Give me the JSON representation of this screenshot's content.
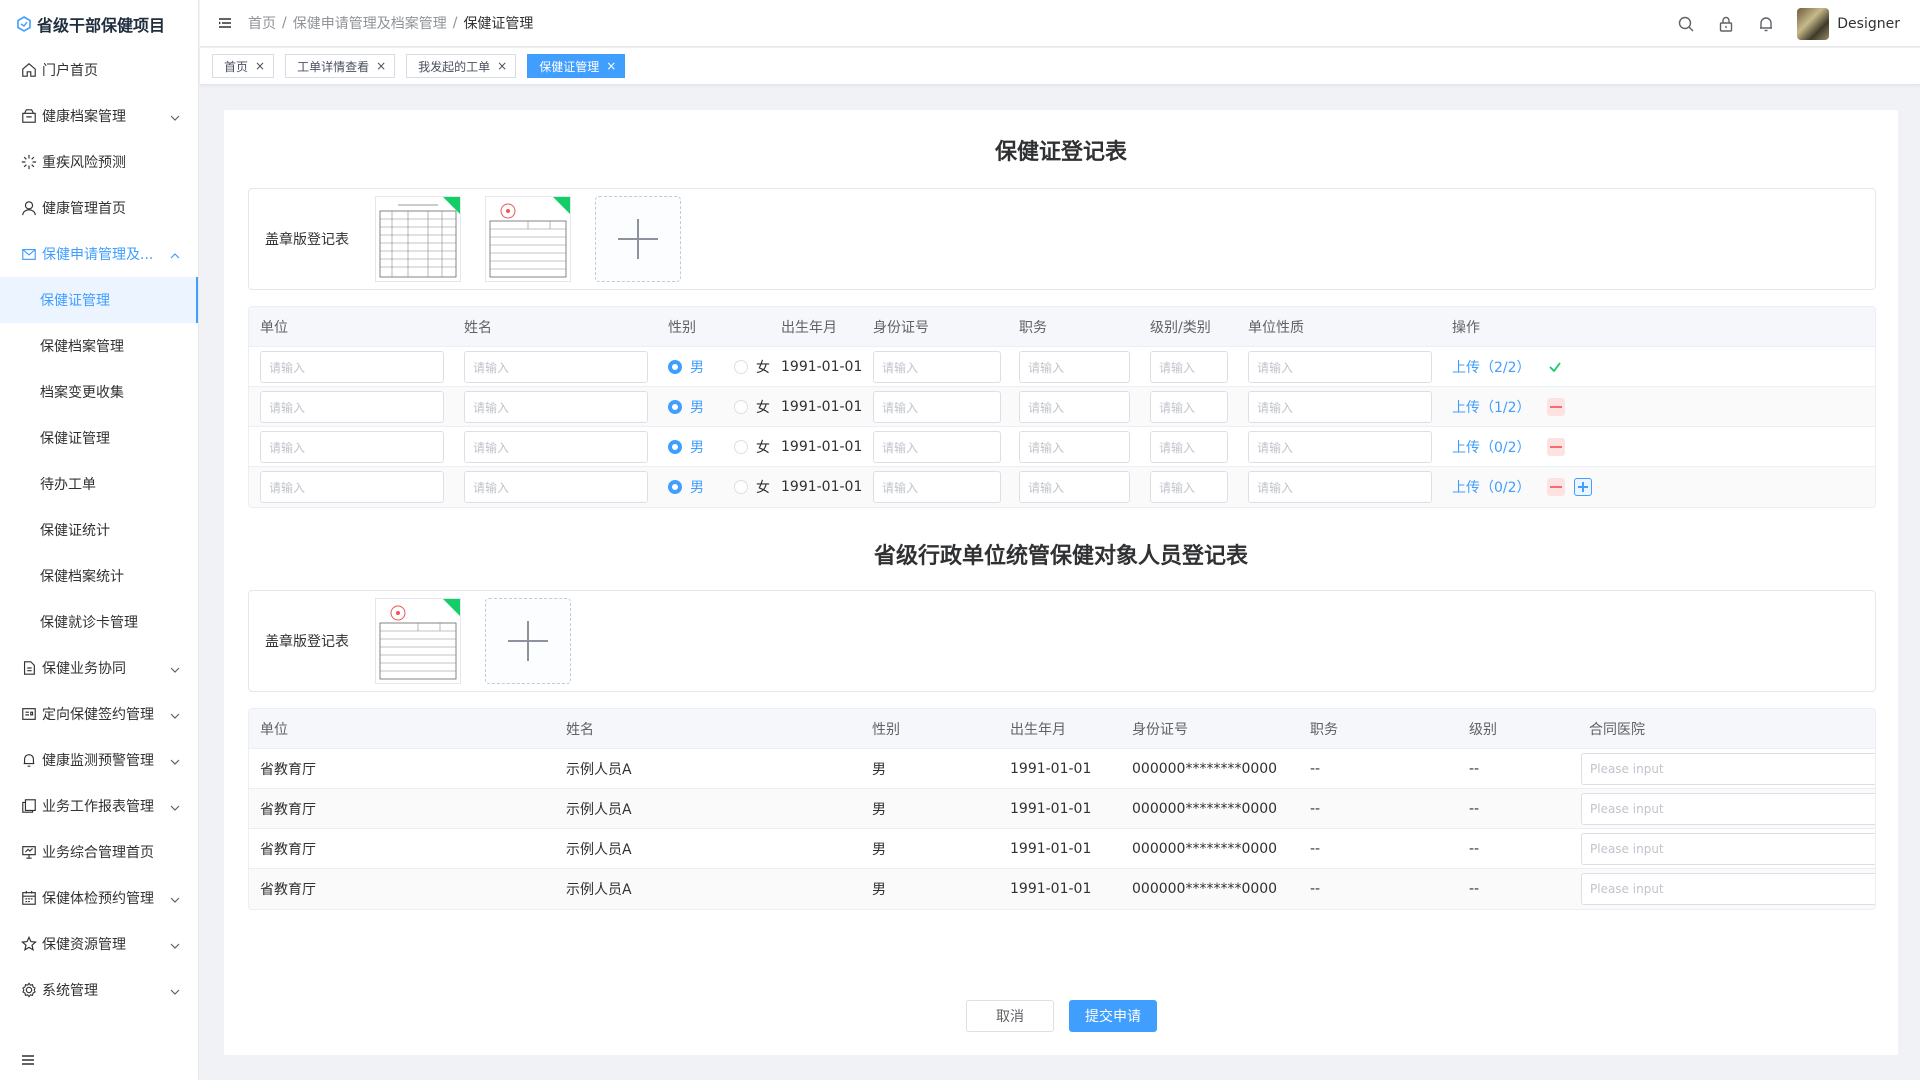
{
  "app": {
    "title": "省级干部保健项目"
  },
  "sidebar": {
    "items": [
      {
        "label": "门户首页",
        "icon": "home-icon",
        "has_children": false
      },
      {
        "label": "健康档案管理",
        "icon": "archive-icon",
        "has_children": true
      },
      {
        "label": "重疾风险预测",
        "icon": "loading-icon",
        "has_children": false
      },
      {
        "label": "健康管理首页",
        "icon": "user-icon",
        "has_children": false
      },
      {
        "label": "保健申请管理及...",
        "icon": "message-icon",
        "has_children": true,
        "open": true
      },
      {
        "label": "保健业务协同",
        "icon": "document-icon",
        "has_children": true
      },
      {
        "label": "定向保健签约管理",
        "icon": "postcard-icon",
        "has_children": true
      },
      {
        "label": "健康监测预警管理",
        "icon": "bell-icon",
        "has_children": true
      },
      {
        "label": "业务工作报表管理",
        "icon": "copy-document-icon",
        "has_children": true
      },
      {
        "label": "业务综合管理首页",
        "icon": "data-board-icon",
        "has_children": false
      },
      {
        "label": "保健体检预约管理",
        "icon": "calendar-icon",
        "has_children": true
      },
      {
        "label": "保健资源管理",
        "icon": "star-icon",
        "has_children": true
      },
      {
        "label": "系统管理",
        "icon": "setting-icon",
        "has_children": true
      }
    ],
    "sub_items": [
      {
        "label": "保健证管理",
        "active": true
      },
      {
        "label": "保健档案管理"
      },
      {
        "label": "档案变更收集"
      },
      {
        "label": "保健证管理"
      },
      {
        "label": "待办工单"
      },
      {
        "label": "保健证统计"
      },
      {
        "label": "保健档案统计"
      },
      {
        "label": "保健就诊卡管理"
      }
    ]
  },
  "header": {
    "breadcrumb": [
      "首页",
      "保健申请管理及档案管理",
      "保健证管理"
    ],
    "breadcrumb_sep": "/",
    "username": "Designer"
  },
  "tabs": [
    {
      "label": "首页",
      "active": false
    },
    {
      "label": "工单详情查看",
      "active": false
    },
    {
      "label": "我发起的工单",
      "active": false
    },
    {
      "label": "保健证管理",
      "active": true
    }
  ],
  "tab_close": "×",
  "form1": {
    "title": "保健证登记表",
    "upload_label": "盖章版登记表",
    "columns": [
      "单位",
      "姓名",
      "性别",
      "出生年月",
      "身份证号",
      "职务",
      "级别/类别",
      "单位性质",
      "操作"
    ],
    "placeholder": "请输入",
    "gender_male": "男",
    "gender_female": "女",
    "rows": [
      {
        "birth": "1991-01-01",
        "upload": "上传（2/2）",
        "status": "done"
      },
      {
        "birth": "1991-01-01",
        "upload": "上传（1/2）",
        "status": "remove"
      },
      {
        "birth": "1991-01-01",
        "upload": "上传（0/2）",
        "status": "remove"
      },
      {
        "birth": "1991-01-01",
        "upload": "上传（0/2）",
        "status": "remove-add"
      }
    ]
  },
  "form2": {
    "title": "省级行政单位统管保健对象人员登记表",
    "upload_label": "盖章版登记表",
    "columns": [
      "单位",
      "姓名",
      "性别",
      "出生年月",
      "身份证号",
      "职务",
      "级别",
      "合同医院"
    ],
    "placeholder": "Please input",
    "rows": [
      {
        "unit": "省教育厅",
        "name": "示例人员A",
        "gender": "男",
        "birth": "1991-01-01",
        "id": "000000********0000",
        "position": "--",
        "level": "--"
      },
      {
        "unit": "省教育厅",
        "name": "示例人员A",
        "gender": "男",
        "birth": "1991-01-01",
        "id": "000000********0000",
        "position": "--",
        "level": "--"
      },
      {
        "unit": "省教育厅",
        "name": "示例人员A",
        "gender": "男",
        "birth": "1991-01-01",
        "id": "000000********0000",
        "position": "--",
        "level": "--"
      },
      {
        "unit": "省教育厅",
        "name": "示例人员A",
        "gender": "男",
        "birth": "1991-01-01",
        "id": "000000********0000",
        "position": "--",
        "level": "--"
      }
    ]
  },
  "footer": {
    "cancel": "取消",
    "submit": "提交申请"
  },
  "colors": {
    "primary": "#409eff",
    "danger": "#f56c6c",
    "success": "#13ce66"
  }
}
